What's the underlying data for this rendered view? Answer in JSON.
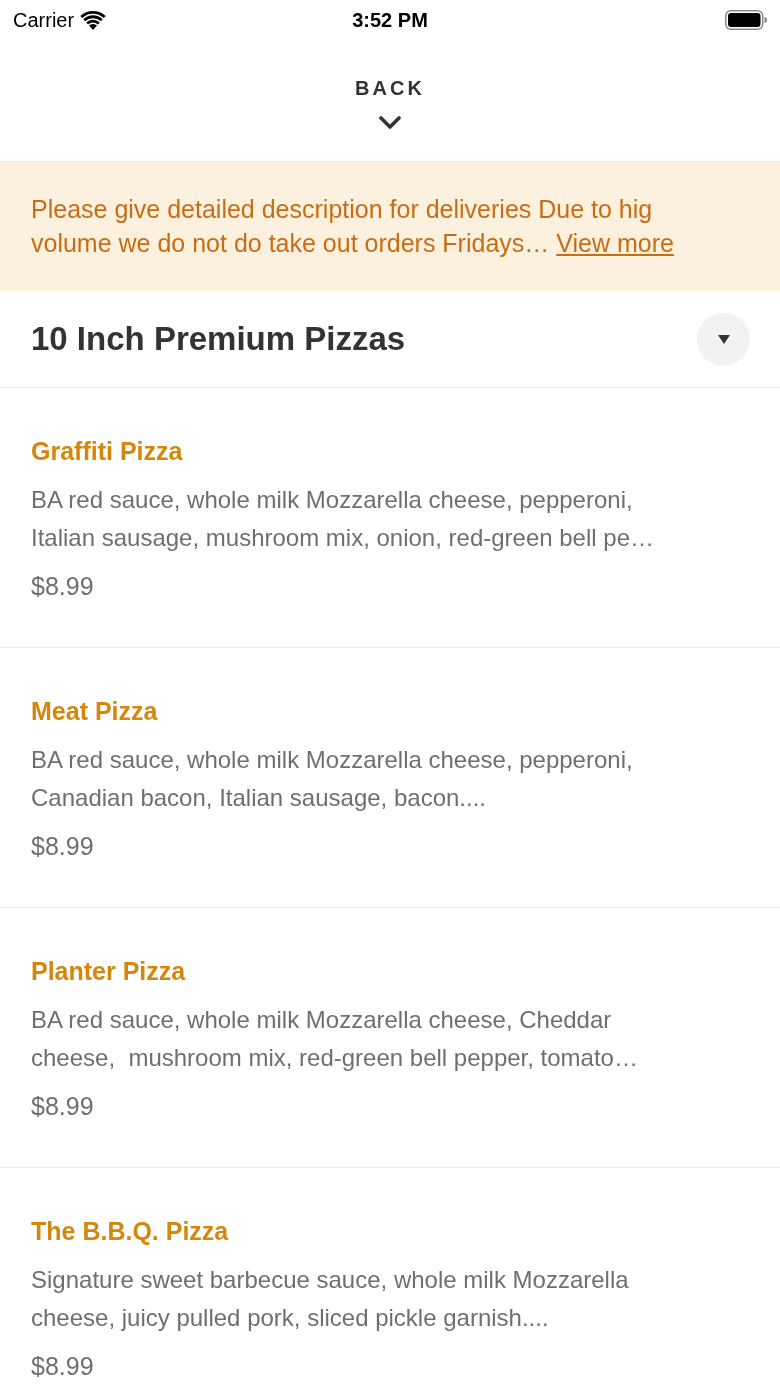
{
  "status_bar": {
    "carrier": "Carrier",
    "time": "3:52 PM"
  },
  "header": {
    "back_label": "BACK"
  },
  "notice": {
    "text": "Please give detailed description for deliveries Due to hig\nvolume we do not do take out orders Fridays…",
    "link": "View more"
  },
  "section": {
    "title": "10 Inch Premium Pizzas"
  },
  "items": [
    {
      "name": "Graffiti Pizza",
      "description": "BA red sauce, whole milk Mozzarella cheese, pepperoni,\nItalian sausage, mushroom mix, onion, red-green bell pe…",
      "price": "$8.99"
    },
    {
      "name": "Meat Pizza",
      "description": "BA red sauce, whole milk Mozzarella cheese, pepperoni,\nCanadian bacon, Italian sausage, bacon....",
      "price": "$8.99"
    },
    {
      "name": "Planter Pizza",
      "description": "BA red sauce, whole milk Mozzarella cheese, Cheddar\ncheese,  mushroom mix, red-green bell pepper, tomato…",
      "price": "$8.99"
    },
    {
      "name": "The B.B.Q. Pizza",
      "description": "Signature sweet barbecue sauce, whole milk Mozzarella\ncheese, juicy pulled pork, sliced pickle garnish....",
      "price": "$8.99"
    }
  ]
}
